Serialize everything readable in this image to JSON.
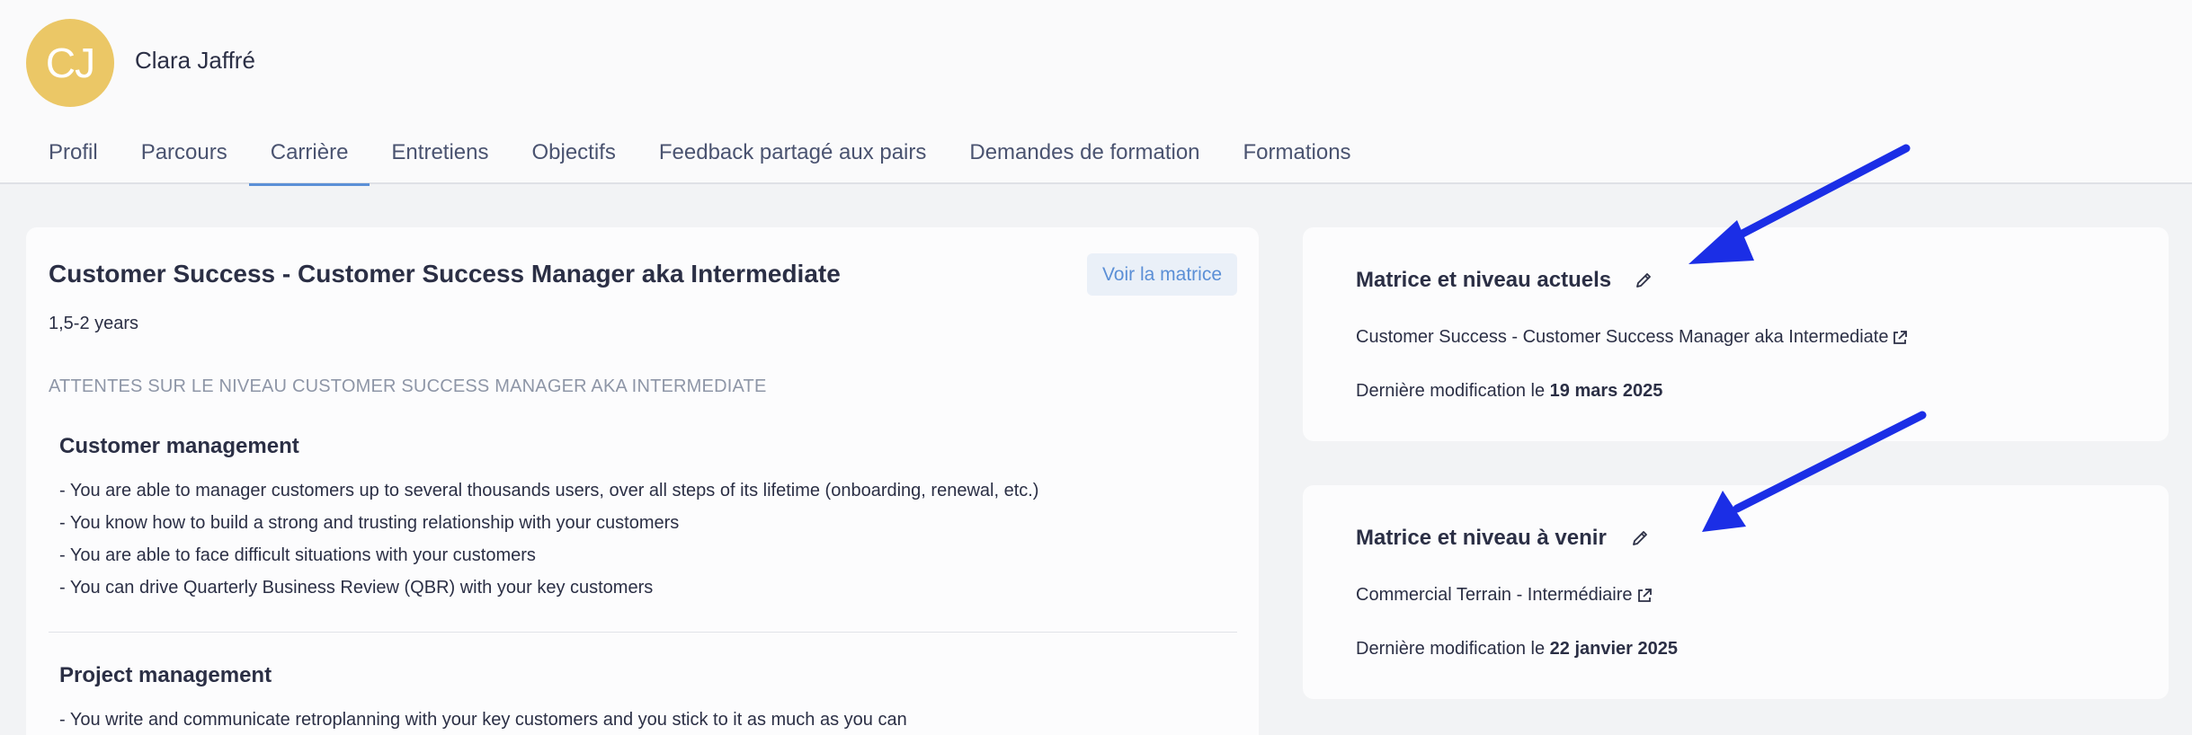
{
  "user": {
    "initials": "CJ",
    "name": "Clara Jaffré"
  },
  "tabs": [
    {
      "label": "Profil"
    },
    {
      "label": "Parcours"
    },
    {
      "label": "Carrière",
      "active": true
    },
    {
      "label": "Entretiens"
    },
    {
      "label": "Objectifs"
    },
    {
      "label": "Feedback partagé aux pairs"
    },
    {
      "label": "Demandes de formation"
    },
    {
      "label": "Formations"
    }
  ],
  "level": {
    "title": "Customer Success - Customer Success Manager aka Intermediate",
    "view_matrix_label": "Voir la matrice",
    "years": "1,5-2 years",
    "expectations_heading": "ATTENTES SUR LE NIVEAU CUSTOMER SUCCESS MANAGER AKA INTERMEDIATE",
    "sections": [
      {
        "title": "Customer management",
        "items": [
          "- You are able to manager customers up to several thousands users, over all steps of its lifetime (onboarding, renewal, etc.)",
          "- You know how to build a strong and trusting relationship with your customers",
          "- You are able to face difficult situations with your customers",
          "- You can drive Quarterly Business Review (QBR) with your key customers"
        ]
      },
      {
        "title": "Project management",
        "items": [
          "- You write and communicate retroplanning with your key customers and you stick to it as much as you can"
        ]
      }
    ]
  },
  "current_matrix": {
    "title": "Matrice et niveau actuels",
    "link": "Customer Success - Customer Success Manager aka Intermediate",
    "modified_prefix": "Dernière modification le ",
    "modified_date": "19 mars 2025"
  },
  "upcoming_matrix": {
    "title": "Matrice et niveau à venir",
    "link": "Commercial Terrain - Intermédiaire",
    "modified_prefix": "Dernière modification le ",
    "modified_date": "22 janvier 2025"
  },
  "colors": {
    "accent": "#5b8fd6",
    "avatar": "#ebc766",
    "annotation_arrow": "#1b2ee6"
  },
  "icons": [
    "pencil-icon",
    "external-link-icon",
    "annotation-arrow"
  ]
}
